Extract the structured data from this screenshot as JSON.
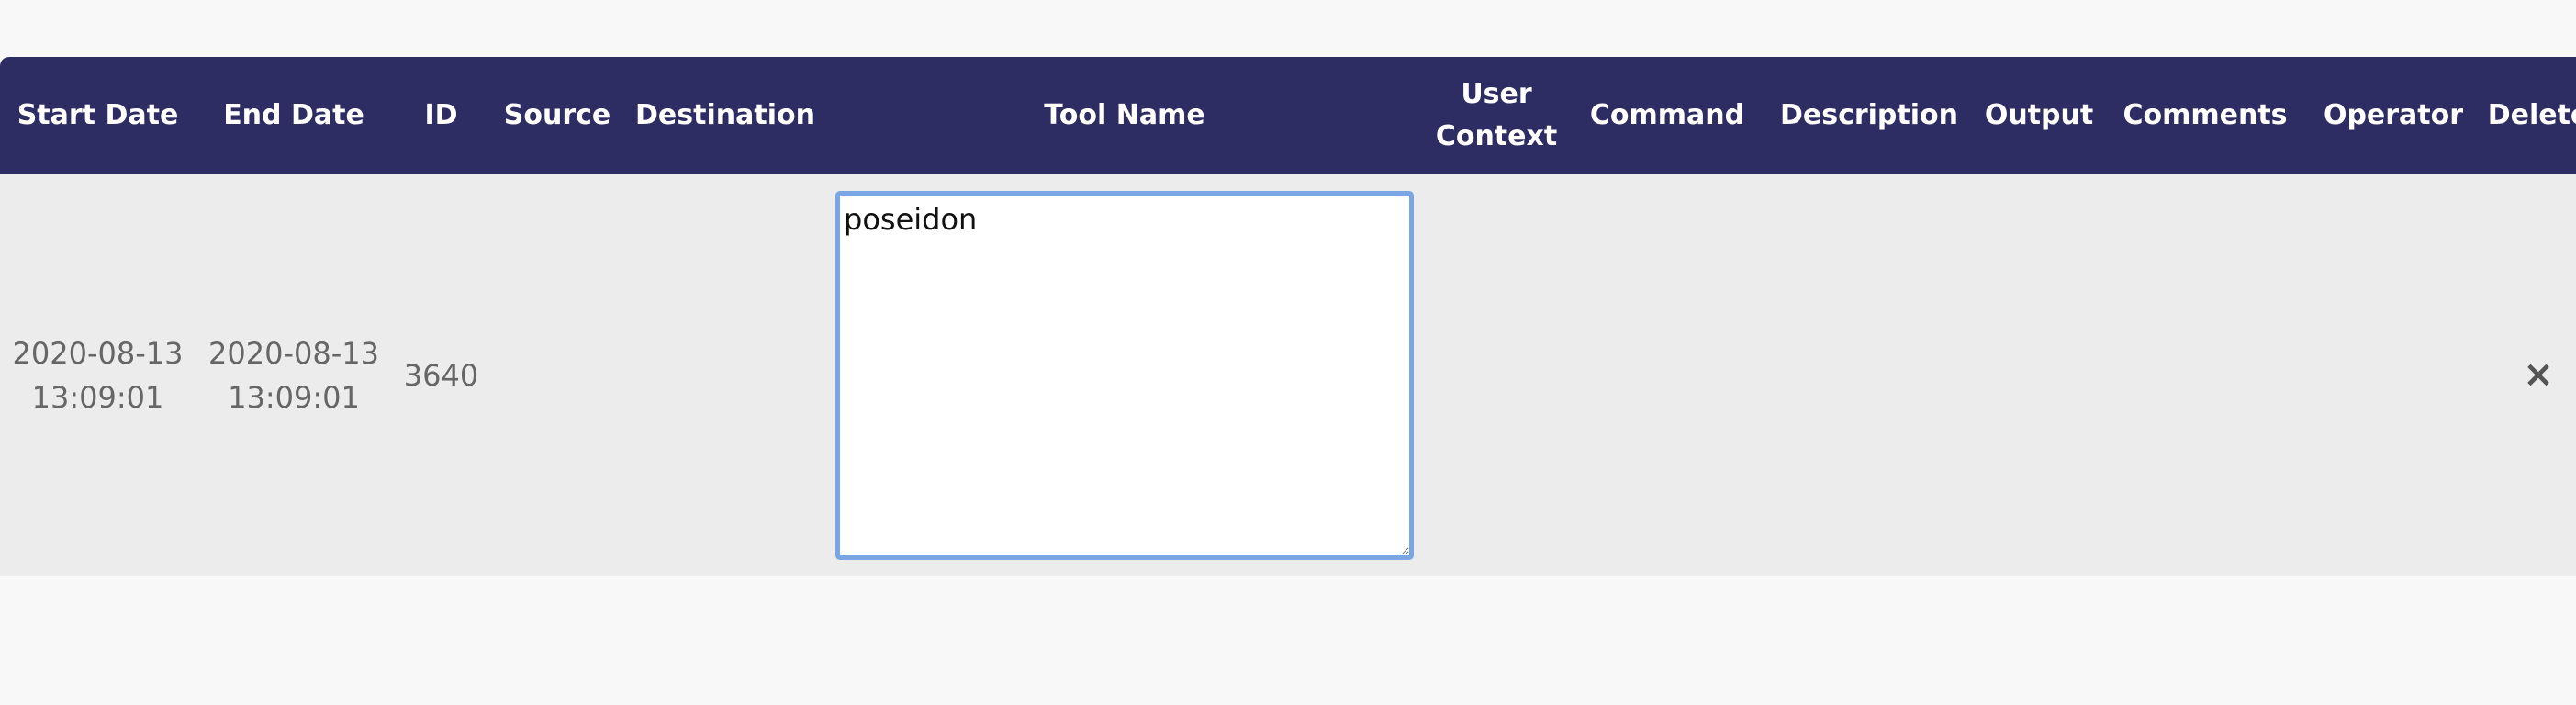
{
  "columns": [
    {
      "label": "Start Date"
    },
    {
      "label": "End Date"
    },
    {
      "label": "ID"
    },
    {
      "label": "Source"
    },
    {
      "label": "Destination"
    },
    {
      "label": "Tool Name"
    },
    {
      "label": "User Context"
    },
    {
      "label": "Command"
    },
    {
      "label": "Description"
    },
    {
      "label": "Output"
    },
    {
      "label": "Comments"
    },
    {
      "label": "Operator"
    },
    {
      "label": "Delete"
    }
  ],
  "row": {
    "start_date": "2020-08-13 13:09:01",
    "end_date": "2020-08-13 13:09:01",
    "id": "3640",
    "source": "",
    "destination": "",
    "tool_name": "poseidon",
    "user_context": "",
    "command": "",
    "description": "",
    "output": "",
    "comments": "",
    "operator": "",
    "delete_glyph": "×"
  }
}
